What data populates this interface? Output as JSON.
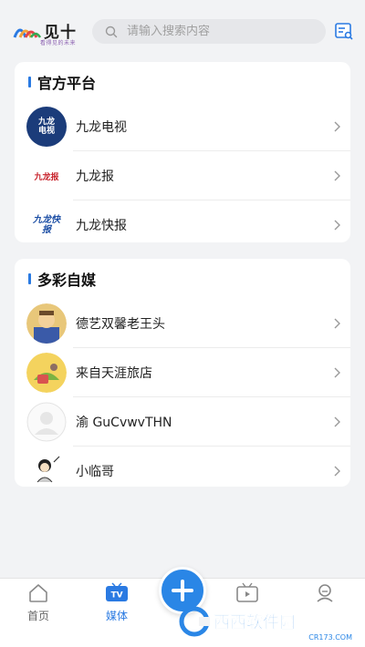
{
  "header": {
    "app_name": "见十",
    "app_tagline": "看得见的未来",
    "search_placeholder": "请输入搜索内容"
  },
  "official": {
    "title": "官方平台",
    "items": [
      {
        "label": "九龙电视",
        "icon": "jiulong-tv-logo",
        "logo_text": "九龙电视"
      },
      {
        "label": "九龙报",
        "icon": "jiulong-newspaper-logo",
        "logo_text": "九龙报"
      },
      {
        "label": "九龙快报",
        "icon": "jiulong-express-logo",
        "logo_text": "九龙快报"
      }
    ]
  },
  "media": {
    "title": "多彩自媒",
    "items": [
      {
        "label": "德艺双馨老王头",
        "icon": "avatar-cartoon-man"
      },
      {
        "label": "来自天涯旅店",
        "icon": "avatar-cartoon-food"
      },
      {
        "label": "渝 GuCvwvTHN",
        "icon": "avatar-default"
      },
      {
        "label": "小临哥",
        "icon": "avatar-sketch"
      }
    ]
  },
  "tabbar": {
    "home": "首页",
    "media": "媒体",
    "tv_badge": "TV"
  },
  "watermark": {
    "text": "西西软件园",
    "url": "CR173.COM"
  },
  "colors": {
    "accent": "#2a7ae2",
    "background": "#f2f3f5"
  }
}
